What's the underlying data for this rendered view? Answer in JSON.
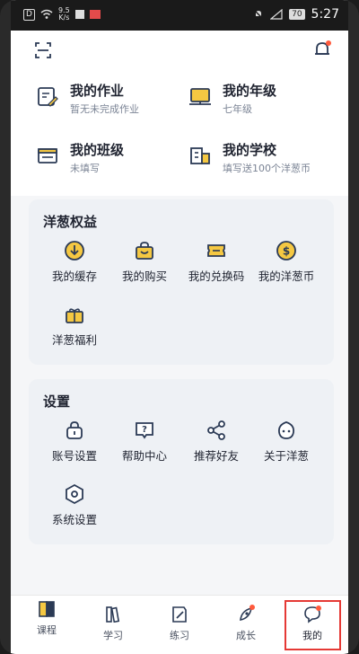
{
  "status_bar": {
    "left_chip": "D",
    "speed_top": "9.5",
    "speed_bottom": "K/s",
    "battery": "70",
    "time": "5:27"
  },
  "top_bar": {
    "left_icon": "scan-icon",
    "right_icon": "bell-icon"
  },
  "quick_links": [
    {
      "title": "我的作业",
      "sub": "暂无未完成作业",
      "icon": "homework-icon"
    },
    {
      "title": "我的年级",
      "sub": "七年级",
      "icon": "grade-icon"
    },
    {
      "title": "我的班级",
      "sub": "未填写",
      "icon": "class-icon"
    },
    {
      "title": "我的学校",
      "sub": "填写送100个洋葱币",
      "icon": "school-icon"
    }
  ],
  "benefits": {
    "title": "洋葱权益",
    "items": [
      {
        "label": "我的缓存",
        "icon": "download-icon"
      },
      {
        "label": "我的购买",
        "icon": "shopping-bag-icon"
      },
      {
        "label": "我的兑换码",
        "icon": "ticket-icon"
      },
      {
        "label": "我的洋葱币",
        "icon": "coin-icon"
      },
      {
        "label": "洋葱福利",
        "icon": "gift-icon"
      }
    ]
  },
  "settings": {
    "title": "设置",
    "items": [
      {
        "label": "账号设置",
        "icon": "lock-icon"
      },
      {
        "label": "帮助中心",
        "icon": "help-icon"
      },
      {
        "label": "推荐好友",
        "icon": "share-icon"
      },
      {
        "label": "关于洋葱",
        "icon": "onion-icon"
      },
      {
        "label": "系统设置",
        "icon": "hexagon-icon"
      }
    ]
  },
  "bottom_nav": [
    {
      "label": "课程",
      "icon": "book-icon"
    },
    {
      "label": "学习",
      "icon": "books-icon"
    },
    {
      "label": "练习",
      "icon": "practice-icon"
    },
    {
      "label": "成长",
      "icon": "rocket-icon"
    },
    {
      "label": "我的",
      "icon": "chat-profile-icon"
    }
  ],
  "colors": {
    "accent_yellow": "#f5c842",
    "icon_navy": "#2b3a55",
    "notify_red": "#ff5a3c",
    "highlight_red": "#e53935"
  }
}
